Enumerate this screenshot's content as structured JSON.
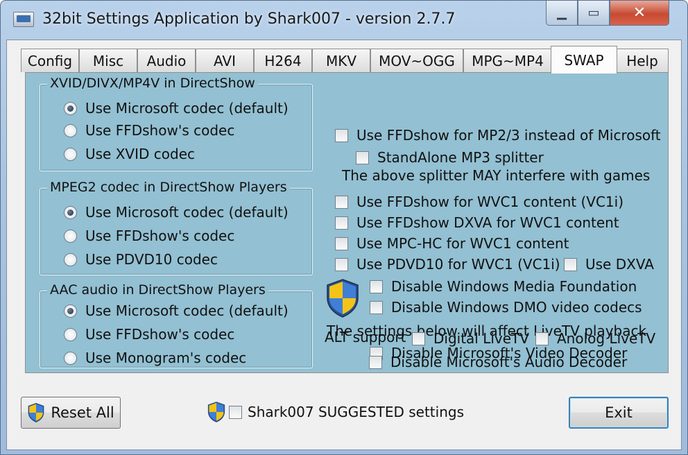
{
  "window": {
    "title": "32bit Settings Application by Shark007 - version 2.7.7"
  },
  "tabs": [
    "Config",
    "Misc",
    "Audio",
    "AVI",
    "H264",
    "MKV",
    "MOV~OGG",
    "MPG~MP4",
    "SWAP",
    "Help"
  ],
  "active_tab": "SWAP",
  "groups": {
    "xvid": {
      "title": "XVID/DIVX/MP4V in DirectShow",
      "options": [
        "Use Microsoft codec (default)",
        "Use FFDshow's codec",
        "Use XVID codec"
      ],
      "selected": 0
    },
    "mpeg2": {
      "title": "MPEG2 codec in DirectShow Players",
      "options": [
        "Use Microsoft codec (default)",
        "Use FFDshow's codec",
        "Use PDVD10 codec"
      ],
      "selected": 0
    },
    "aac": {
      "title": "AAC audio in DirectShow Players",
      "options": [
        "Use Microsoft codec (default)",
        "Use FFDshow's codec",
        "Use Monogram's codec"
      ],
      "selected": 0
    }
  },
  "right": {
    "ffdshow_mp23": "Use FFDshow for MP2/3 instead of Microsoft",
    "standalone_mp3": "StandAlone MP3 splitter",
    "splitter_warning": "The above splitter MAY interfere with games",
    "ffdshow_wvc1": "Use FFDshow for WVC1 content (VC1i)",
    "ffdshow_dxva_wvc1": "Use FFDshow DXVA for WVC1 content",
    "mpchc_wvc1": "Use MPC-HC for WVC1 content",
    "pdvd10_wvc1": "Use PDVD10 for WVC1 (VC1i)",
    "use_dxva": "Use DXVA",
    "disable_wmf": "Disable Windows Media Foundation",
    "disable_dmo": "Disable Windows DMO video codecs",
    "livetv_note": "The settings below will affect LiveTV playback",
    "disable_ms_video": "Disable Microsoft's Video Decoder",
    "alt_support": "ALT support",
    "digital_livetv": "Digital LiveTV",
    "analog_livetv": "Anolog LiveTV",
    "disable_ms_audio": "Disable Microsoft's Audio Decoder"
  },
  "bottom": {
    "reset_all": "Reset All",
    "suggested": "Shark007 SUGGESTED settings",
    "exit": "Exit"
  },
  "colors": {
    "panel": "#93c0d2",
    "dialog": "#f0f0f0",
    "close_button": "#c74a32"
  }
}
